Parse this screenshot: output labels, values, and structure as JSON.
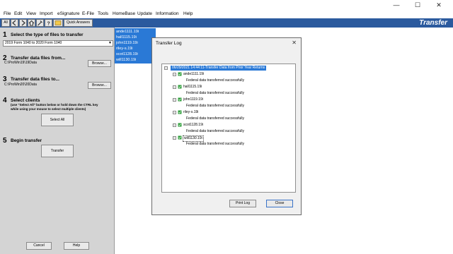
{
  "window": {
    "minimize": "—",
    "maximize": "☐",
    "close": "✕"
  },
  "menu": [
    "File",
    "Edit",
    "View",
    "Import",
    "eSignature",
    "E-File",
    "Tools",
    "HomeBase",
    "Update",
    "Information",
    "Help"
  ],
  "toolbar": {
    "all_label": "All",
    "quick_answers": "Quick Answers",
    "title": "Transfer"
  },
  "steps": {
    "step1": {
      "num": "1",
      "title": "Select the type of files to transfer",
      "select_value": "2019 Form 1040 to 2020 Form 1040"
    },
    "step2": {
      "num": "2",
      "title": "Transfer data files from...",
      "path": "C:\\ProWin19\\19Data",
      "browse": "Browse..."
    },
    "step3": {
      "num": "3",
      "title": "Transfer data files to...",
      "path": "C:\\ProWin20\\20Data",
      "browse": "Browse..."
    },
    "step4": {
      "num": "4",
      "title": "Select clients",
      "hint1": "(use \"Select All\" button below or hold down the CTRL key",
      "hint2": "while using your mouse to select multiple clients)",
      "select_all": "Select All"
    },
    "step5": {
      "num": "5",
      "title": "Begin transfer",
      "transfer": "Transfer"
    }
  },
  "footer": {
    "cancel": "Cancel",
    "help": "Help"
  },
  "clients": [
    "ande1111.19i",
    "hall1115.19i",
    "john1119.19i",
    "riley-s.19i",
    "scot1128.19i",
    "will1130.19i"
  ],
  "dialog": {
    "title": "Transfer Log",
    "root": "06/29/2021 14:44:11-Transfer Data from Prior Year Returns",
    "entries": [
      {
        "file": "ande1111.19i",
        "msg": "Federal data transferred successfully"
      },
      {
        "file": "hall1115.19i",
        "msg": "Federal data transferred successfully"
      },
      {
        "file": "john1119.19i",
        "msg": "Federal data transferred successfully"
      },
      {
        "file": "riley-s.19i",
        "msg": "Federal data transferred successfully"
      },
      {
        "file": "scot1128.19i",
        "msg": "Federal data transferred successfully"
      },
      {
        "file": "will1130.19i",
        "msg": "Federal data transferred successfully"
      }
    ],
    "print_log": "Print Log",
    "close": "Close"
  },
  "colors": {
    "toolbar": "#2b5a9e",
    "selection": "#2a79d6",
    "panel": "#d4d4d4",
    "success_icon": "#2e9e3a"
  }
}
